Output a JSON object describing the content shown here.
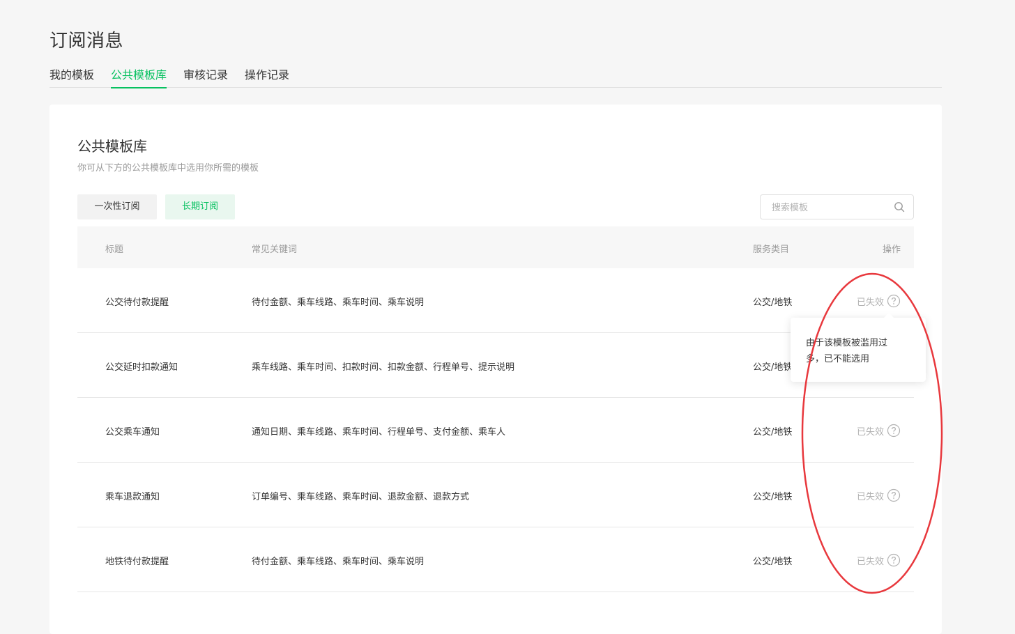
{
  "page": {
    "title": "订阅消息"
  },
  "tabs": [
    {
      "label": "我的模板",
      "active": false
    },
    {
      "label": "公共模板库",
      "active": true
    },
    {
      "label": "审核记录",
      "active": false
    },
    {
      "label": "操作记录",
      "active": false
    }
  ],
  "section": {
    "title": "公共模板库",
    "description": "你可从下方的公共模板库中选用你所需的模板"
  },
  "filters": {
    "once_label": "一次性订阅",
    "long_label": "长期订阅"
  },
  "search": {
    "placeholder": "搜索模板",
    "value": ""
  },
  "table": {
    "headers": {
      "title": "标题",
      "keywords": "常见关键词",
      "category": "服务类目",
      "action": "操作"
    },
    "rows": [
      {
        "title": "公交待付款提醒",
        "keywords": "待付金额、乘车线路、乘车时间、乘车说明",
        "category": "公交/地铁",
        "status": "已失效"
      },
      {
        "title": "公交延时扣款通知",
        "keywords": "乘车线路、乘车时间、扣款时间、扣款金额、行程单号、提示说明",
        "category": "公交/地铁",
        "status": ""
      },
      {
        "title": "公交乘车通知",
        "keywords": "通知日期、乘车线路、乘车时间、行程单号、支付金额、乘车人",
        "category": "公交/地铁",
        "status": "已失效"
      },
      {
        "title": "乘车退款通知",
        "keywords": "订单编号、乘车线路、乘车时间、退款金额、退款方式",
        "category": "公交/地铁",
        "status": "已失效"
      },
      {
        "title": "地铁待付款提醒",
        "keywords": "待付金额、乘车线路、乘车时间、乘车说明",
        "category": "公交/地铁",
        "status": "已失效"
      }
    ]
  },
  "tooltip": {
    "line1": "由于该模板被滥用过",
    "line2": "多，已不能选用"
  },
  "colors": {
    "accent": "#07c160",
    "annotation": "#e8383d",
    "muted": "#b2b2b2"
  },
  "icons": {
    "search": "search-icon",
    "help": "help-circle-icon"
  }
}
